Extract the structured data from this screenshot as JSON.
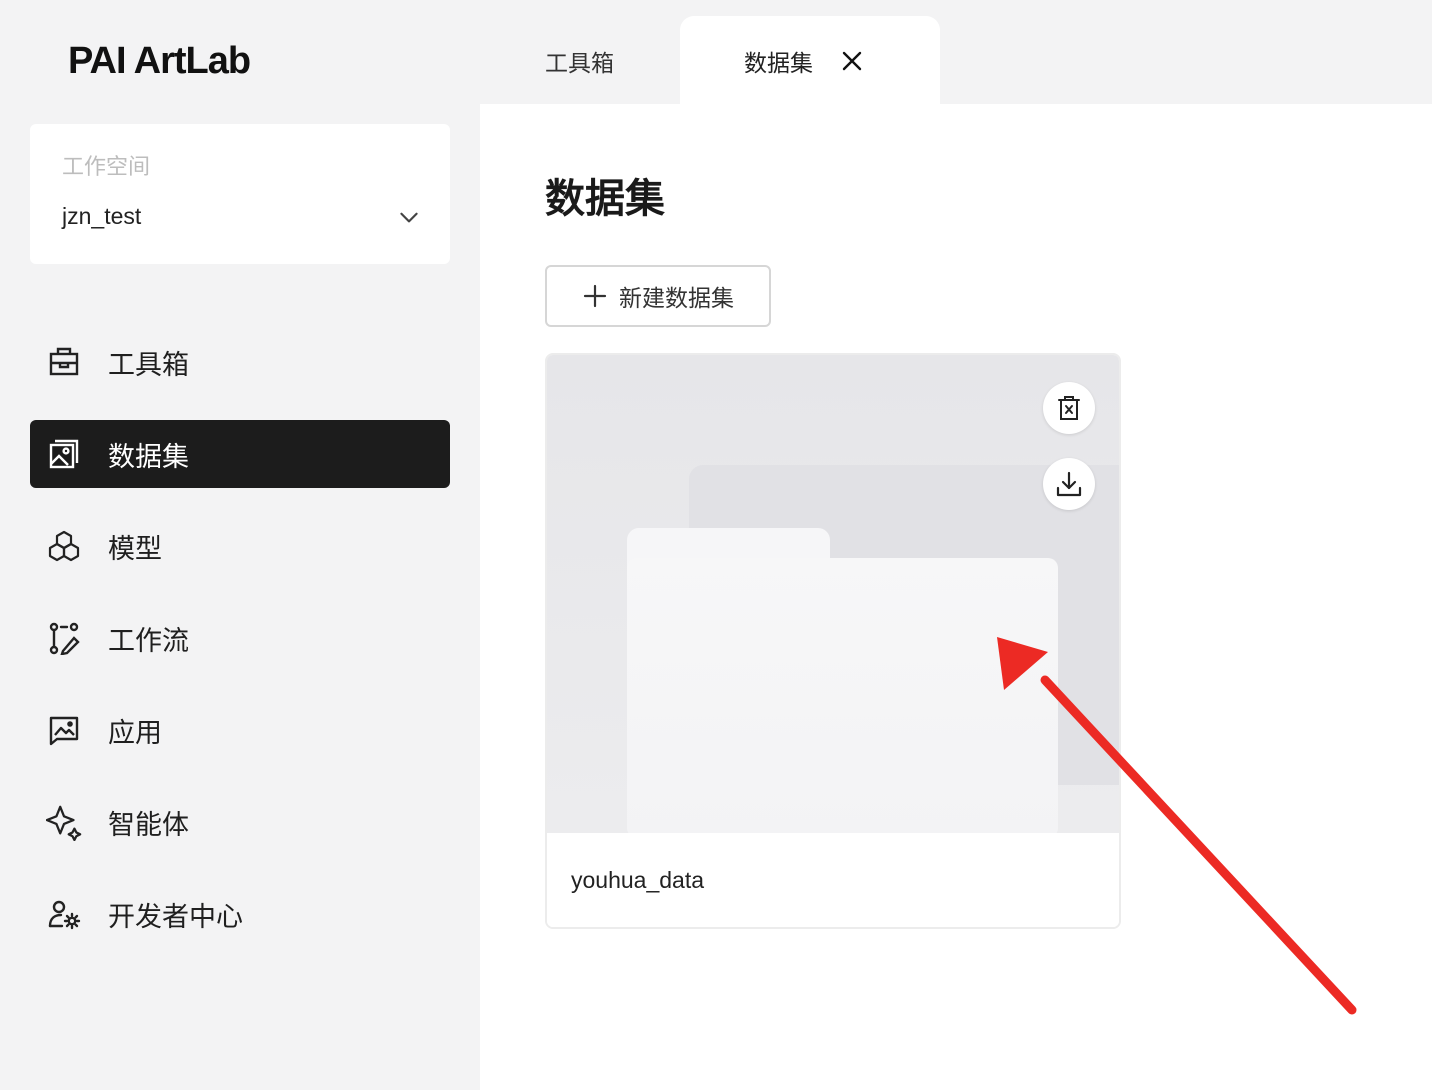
{
  "app": {
    "logo": "PAI ArtLab"
  },
  "workspace": {
    "label": "工作空间",
    "value": "jzn_test"
  },
  "sidebar": {
    "items": [
      {
        "label": "工具箱",
        "icon": "toolbox-icon",
        "active": false
      },
      {
        "label": "数据集",
        "icon": "dataset-image-icon",
        "active": true
      },
      {
        "label": "模型",
        "icon": "model-cubes-icon",
        "active": false
      },
      {
        "label": "工作流",
        "icon": "workflow-icon",
        "active": false
      },
      {
        "label": "应用",
        "icon": "app-gallery-icon",
        "active": false
      },
      {
        "label": "智能体",
        "icon": "sparkle-agent-icon",
        "active": false
      },
      {
        "label": "开发者中心",
        "icon": "developer-user-gear-icon",
        "active": false
      }
    ]
  },
  "tabs": [
    {
      "label": "工具箱",
      "active": false
    },
    {
      "label": "数据集",
      "active": true,
      "closable": true
    }
  ],
  "main": {
    "title": "数据集",
    "new_button_label": "新建数据集",
    "datasets": [
      {
        "name": "youhua_data",
        "actions": [
          "delete-icon",
          "download-icon"
        ]
      }
    ]
  },
  "colors": {
    "active_nav_bg": "#1c1c1c",
    "page_bg": "#f3f3f4",
    "annotation_arrow": "#ec2a24"
  }
}
